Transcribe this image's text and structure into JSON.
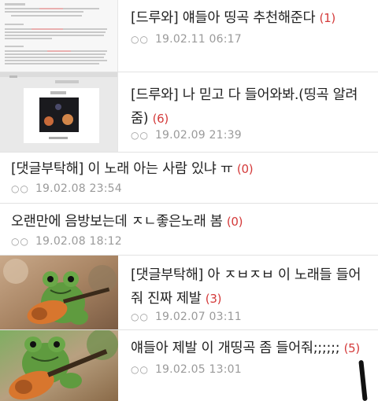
{
  "posts": [
    {
      "tag": "[드루와]",
      "title": "얘들아 띵곡 추천해준다",
      "count": "(1)",
      "icons": "○○",
      "date": "19.02.11 06:17"
    },
    {
      "tag": "[드루와]",
      "title": "나 믿고 다 들어와봐.(띵곡 알려",
      "title2": "줌)",
      "count": "(6)",
      "icons": "○○",
      "date": "19.02.09 21:39"
    },
    {
      "tag": "[댓글부탁해]",
      "title": "이 노래 아는 사람 있냐 ㅠ",
      "count": "(0)",
      "icons": "○○",
      "date": "19.02.08 23:54"
    },
    {
      "tag": "",
      "title": "오랜만에 음방보는데 ㅈㄴ좋은노래 봄",
      "count": "(0)",
      "icons": "○○",
      "date": "19.02.08 18:12"
    },
    {
      "tag": "[댓글부탁해]",
      "title": "아 ㅈㅂㅈㅂ 이 노래들 들어",
      "title2": "줘 진짜 제발",
      "count": "(3)",
      "icons": "○○",
      "date": "19.02.07 03:11"
    },
    {
      "tag": "",
      "title": "얘들아 제발 이 개띵곡 좀 들어줘;;;;;;",
      "count": "(5)",
      "icons": "○○",
      "date": "19.02.05 13:01"
    }
  ],
  "colors": {
    "count": "#d43a3a",
    "meta": "#9a9a9a",
    "text": "#222222"
  },
  "thumbnails": [
    "chat-screenshot",
    "album-cover",
    "frog-guitar",
    "frog-guitar"
  ]
}
